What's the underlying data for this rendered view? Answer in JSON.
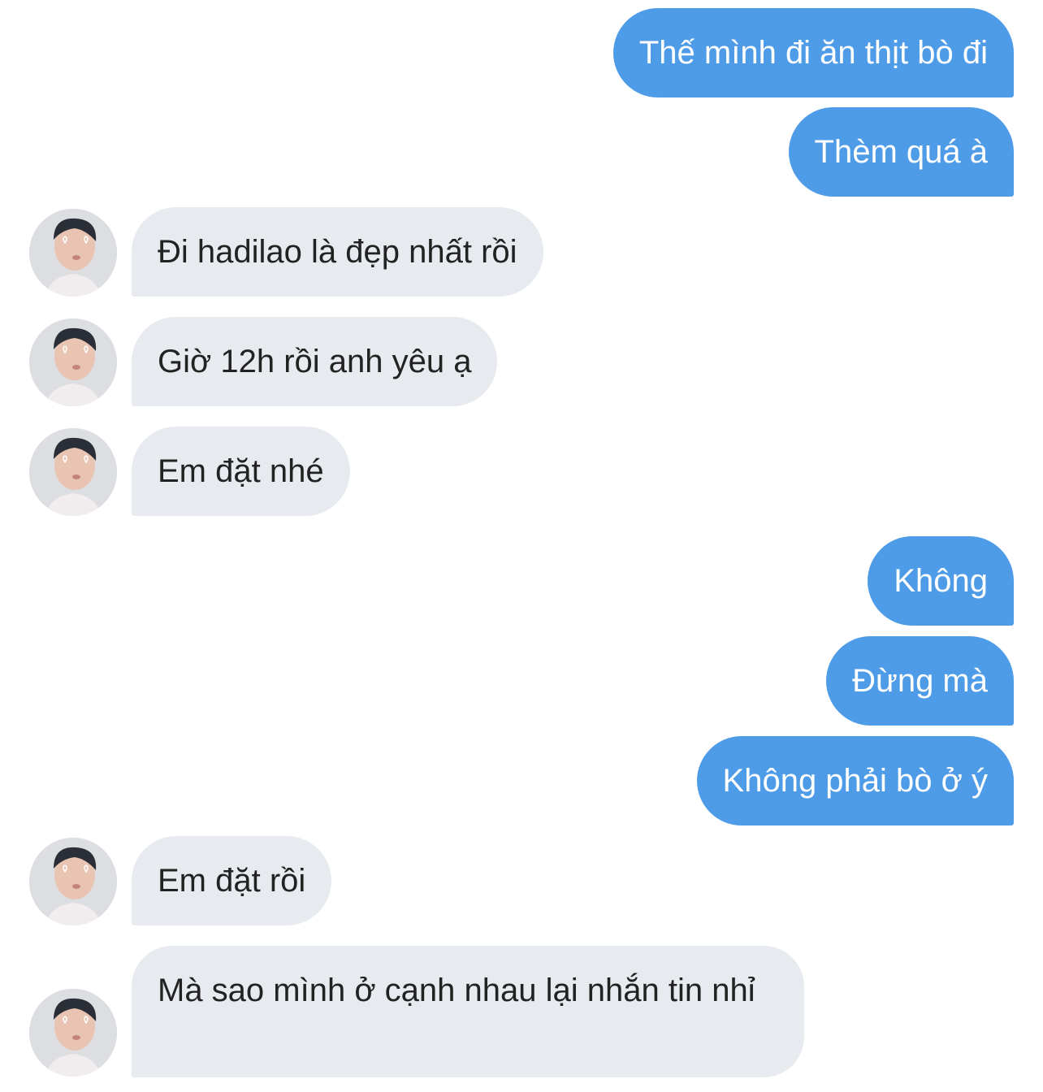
{
  "messages": [
    {
      "sender": "me",
      "text": "Thế mình đi ăn thịt bò đi"
    },
    {
      "sender": "me",
      "text": "Thèm quá à"
    },
    {
      "sender": "them",
      "text": "Đi hadilao là đẹp nhất rồi"
    },
    {
      "sender": "them",
      "text": "Giờ 12h rồi anh yêu ạ"
    },
    {
      "sender": "them",
      "text": "Em đặt nhé"
    },
    {
      "sender": "me",
      "text": "Không"
    },
    {
      "sender": "me",
      "text": "Đừng mà"
    },
    {
      "sender": "me",
      "text": "Không phải bò ở ý"
    },
    {
      "sender": "them",
      "text": "Em đặt rồi"
    },
    {
      "sender": "them",
      "text": "Mà sao mình ở cạnh nhau lại nhắn tin nhỉ"
    }
  ],
  "colors": {
    "outgoing_bubble": "#4e9be8",
    "outgoing_text": "#ffffff",
    "incoming_bubble": "#e7eaee",
    "incoming_text": "#222222",
    "background": "#ffffff"
  },
  "icons": {
    "avatar": "contact-avatar-photo"
  }
}
